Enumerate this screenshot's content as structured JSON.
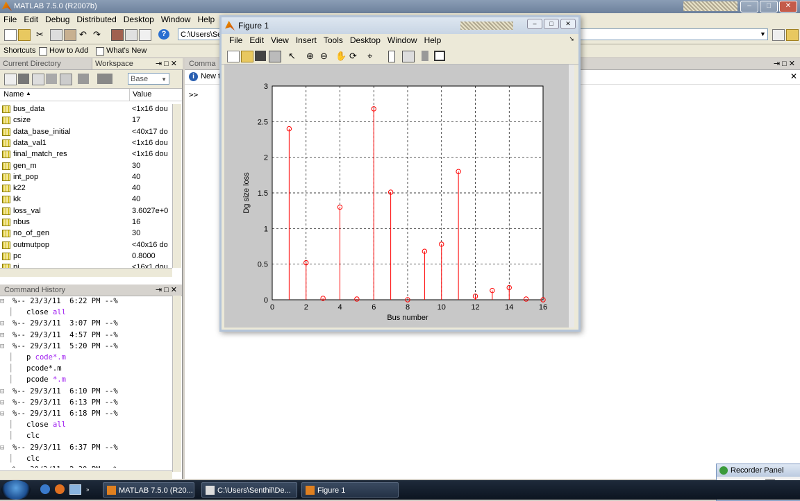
{
  "app": {
    "title": "MATLAB  7.5.0 (R2007b)",
    "menus": [
      "File",
      "Edit",
      "Debug",
      "Distributed",
      "Desktop",
      "Window",
      "Help"
    ],
    "current_path": "C:\\Users\\Se",
    "shortcuts": {
      "label": "Shortcuts",
      "how_to_add": "How to Add",
      "whats_new": "What's New"
    }
  },
  "workspace": {
    "tab_current_directory": "Current Directory",
    "tab_workspace": "Workspace",
    "stack_value": "Base",
    "col_name": "Name",
    "col_value": "Value",
    "variables": [
      {
        "name": "bus_data",
        "value": "<1x16 dou"
      },
      {
        "name": "csize",
        "value": "17"
      },
      {
        "name": "data_base_initial",
        "value": "<40x17 do"
      },
      {
        "name": "data_val1",
        "value": "<1x16 dou"
      },
      {
        "name": "final_match_res",
        "value": "<1x16 dou"
      },
      {
        "name": "gen_m",
        "value": "30"
      },
      {
        "name": "int_pop",
        "value": "40"
      },
      {
        "name": "k22",
        "value": "40"
      },
      {
        "name": "kk",
        "value": "40"
      },
      {
        "name": "loss_val",
        "value": "3.6027e+0"
      },
      {
        "name": "nbus",
        "value": "16"
      },
      {
        "name": "no_of_gen",
        "value": "30"
      },
      {
        "name": "outmutpop",
        "value": "<40x16 do"
      },
      {
        "name": "pc",
        "value": "0.8000"
      },
      {
        "name": "pi",
        "value": "<16x1 dou"
      }
    ]
  },
  "history": {
    "title": "Command History",
    "lines": [
      {
        "indent": 0,
        "text": "%-- 23/3/11  6:22 PM --%",
        "kw": ""
      },
      {
        "indent": 1,
        "text": "close ",
        "kw": "all"
      },
      {
        "indent": 0,
        "text": "%-- 29/3/11  3:07 PM --%",
        "kw": ""
      },
      {
        "indent": 0,
        "text": "%-- 29/3/11  4:57 PM --%",
        "kw": ""
      },
      {
        "indent": 0,
        "text": "%-- 29/3/11  5:20 PM --%",
        "kw": ""
      },
      {
        "indent": 1,
        "text": "p ",
        "kw": "code*.m"
      },
      {
        "indent": 1,
        "text": "pcode*.m",
        "kw": ""
      },
      {
        "indent": 1,
        "text": "pcode ",
        "kw": "*.m"
      },
      {
        "indent": 0,
        "text": "%-- 29/3/11  6:10 PM --%",
        "kw": ""
      },
      {
        "indent": 0,
        "text": "%-- 29/3/11  6:13 PM --%",
        "kw": ""
      },
      {
        "indent": 0,
        "text": "%-- 29/3/11  6:18 PM --%",
        "kw": ""
      },
      {
        "indent": 1,
        "text": "close ",
        "kw": "all"
      },
      {
        "indent": 1,
        "text": "clc",
        "kw": ""
      },
      {
        "indent": 0,
        "text": "%-- 29/3/11  6:37 PM --%",
        "kw": ""
      },
      {
        "indent": 1,
        "text": "clc",
        "kw": ""
      },
      {
        "indent": 0,
        "text": "%-- 30/3/11  2:39 PM --%",
        "kw": ""
      }
    ]
  },
  "command_window": {
    "title": "Comma",
    "new_notice": "New t",
    "prompt": ">>"
  },
  "figure": {
    "title": "Figure 1",
    "menus": [
      "File",
      "Edit",
      "View",
      "Insert",
      "Tools",
      "Desktop",
      "Window",
      "Help"
    ]
  },
  "chart_data": {
    "type": "stem",
    "x": [
      1,
      2,
      3,
      4,
      5,
      6,
      7,
      8,
      9,
      10,
      11,
      12,
      13,
      14,
      15,
      16
    ],
    "values": [
      2.4,
      0.52,
      0.02,
      1.3,
      0.01,
      2.68,
      1.51,
      0.0,
      0.68,
      0.78,
      1.8,
      0.05,
      0.13,
      0.17,
      0.01,
      0.0
    ],
    "xlabel": "Bus number",
    "ylabel": "Dg size loss",
    "xlim": [
      0,
      16
    ],
    "ylim": [
      0,
      3
    ],
    "xticks": [
      0,
      2,
      4,
      6,
      8,
      10,
      12,
      14,
      16
    ],
    "yticks": [
      0,
      0.5,
      1,
      1.5,
      2,
      2.5,
      3
    ],
    "ytick_labels": [
      "0",
      "0.5",
      "1",
      "1.5",
      "2",
      "2.5",
      "3"
    ],
    "grid": true,
    "color": "#ff0000"
  },
  "taskbar": {
    "tasks": [
      "MATLAB  7.5.0 (R20...",
      "C:\\Users\\Senthil\\De...",
      "Figure 1"
    ]
  },
  "recorder": {
    "title": "Recorder Panel"
  }
}
